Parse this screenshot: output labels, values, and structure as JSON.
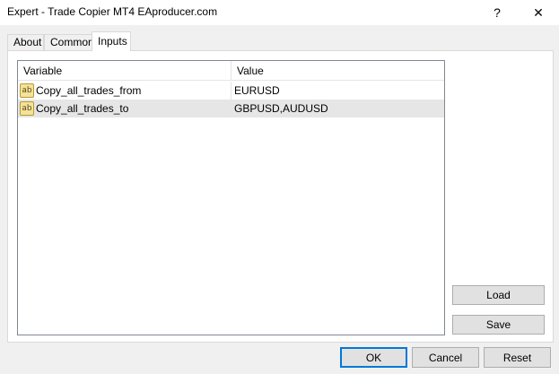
{
  "window": {
    "title": "Expert - Trade Copier MT4 EAproducer.com",
    "help_glyph": "?",
    "close_glyph": "✕"
  },
  "tabs": [
    {
      "label": "About"
    },
    {
      "label": "Common"
    },
    {
      "label": "Inputs",
      "active": true
    }
  ],
  "grid": {
    "headers": {
      "variable": "Variable",
      "value": "Value"
    },
    "rows": [
      {
        "type_icon": "ab-string-icon",
        "icon_text": "ab",
        "variable": "Copy_all_trades_from",
        "value": "EURUSD",
        "selected": false
      },
      {
        "type_icon": "ab-string-icon",
        "icon_text": "ab",
        "variable": "Copy_all_trades_to",
        "value": "GBPUSD,AUDUSD",
        "selected": true
      }
    ]
  },
  "side_buttons": {
    "load": "Load",
    "save": "Save"
  },
  "dialog_buttons": {
    "ok": "OK",
    "cancel": "Cancel",
    "reset": "Reset"
  },
  "colors": {
    "focus_border": "#0078d7",
    "selected_row": "#e6e6e6"
  }
}
